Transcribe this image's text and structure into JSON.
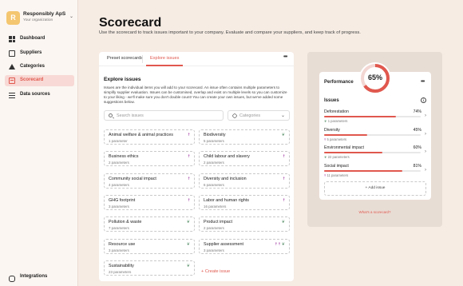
{
  "org": {
    "logo_letter": "R",
    "name": "Responsibly ApS",
    "subtitle": "Your organization",
    "logo_color": "#f4c66f"
  },
  "sidebar": {
    "items": [
      {
        "label": "Dashboard",
        "icon": "dashboard-icon",
        "active": false
      },
      {
        "label": "Suppliers",
        "icon": "suppliers-icon",
        "active": false
      },
      {
        "label": "Categories",
        "icon": "categories-icon",
        "active": false
      },
      {
        "label": "Scorecard",
        "icon": "scorecard-icon",
        "active": true
      },
      {
        "label": "Data sources",
        "icon": "data-sources-icon",
        "active": false
      }
    ],
    "bottom": {
      "label": "Integrations",
      "icon": "integrations-icon"
    }
  },
  "page": {
    "title": "Scorecard",
    "description": "Use the scorecard to track issues important to your company. Evaluate and compare your suppliers, and keep track of progress."
  },
  "tabs": [
    {
      "label": "Preset scorecards",
      "active": false
    },
    {
      "label": "Explore issues",
      "active": true
    }
  ],
  "explore": {
    "title": "Explore issues",
    "description": "Issues are the individual items you will add to your scorecard. An issue often contains multiple parameters to simplify supplier evaluation. Issues can be customised, overlap and exist on multiple levels so you can customize to your liking - we'll make sure you don't double count! You can create your own issues, but we've added some suggestions below.",
    "search_placeholder": "Search issues",
    "categories_placeholder": "Categories",
    "create_label": "+ Create issue"
  },
  "issues": [
    {
      "name": "Animal welfare & animal practices",
      "params": "1 parameter",
      "badge": "person"
    },
    {
      "name": "Biodiversity",
      "params": "5 parameters",
      "badge": "leaf"
    },
    {
      "name": "Business ethics",
      "params": "2 parameters",
      "badge": "person"
    },
    {
      "name": "Child labour and slavery",
      "params": "2 parameters",
      "badge": "person"
    },
    {
      "name": "Community social impact",
      "params": "4 parameters",
      "badge": "person"
    },
    {
      "name": "Diversity and inclusion",
      "params": "6 parameters",
      "badge": "person"
    },
    {
      "name": "GHG footprint",
      "params": "3 parameters",
      "badge": "person"
    },
    {
      "name": "Labor and human rights",
      "params": "16 parameters",
      "badge": "person"
    },
    {
      "name": "Pollution & waste",
      "params": "7 parameters",
      "badge": "leaf"
    },
    {
      "name": "Product impact",
      "params": "2 parameters",
      "badge": "leaf"
    },
    {
      "name": "Resource use",
      "params": "3 parameters",
      "badge": "leaf"
    },
    {
      "name": "Supplier assessment",
      "params": "3 parameters",
      "badge": "mixed"
    },
    {
      "name": "Sustainability",
      "params": "23 parameters",
      "badge": "leaf"
    }
  ],
  "performance": {
    "label": "Performance",
    "value": 65,
    "value_label": "65%",
    "issues_label": "Issues",
    "rows": [
      {
        "name": "Deforestation",
        "pct": 74,
        "pct_label": "74%",
        "sub": "1 parameters",
        "badge": "leaf"
      },
      {
        "name": "Diversity",
        "pct": 45,
        "pct_label": "45%",
        "sub": "5 parameters",
        "badge": "person"
      },
      {
        "name": "Environmental impact",
        "pct": 60,
        "pct_label": "60%",
        "sub": "22 parameters",
        "badge": "leaf"
      },
      {
        "name": "Social impact",
        "pct": 81,
        "pct_label": "81%",
        "sub": "11 parameters",
        "badge": "mixed"
      }
    ],
    "add_label": "+ Add issue",
    "what_label": "What's a scorecard?"
  },
  "colors": {
    "accent": "#e0584e",
    "person_badge": "#a43fa6",
    "leaf_badge": "#6a9c7a",
    "background": "#f6ece4"
  }
}
